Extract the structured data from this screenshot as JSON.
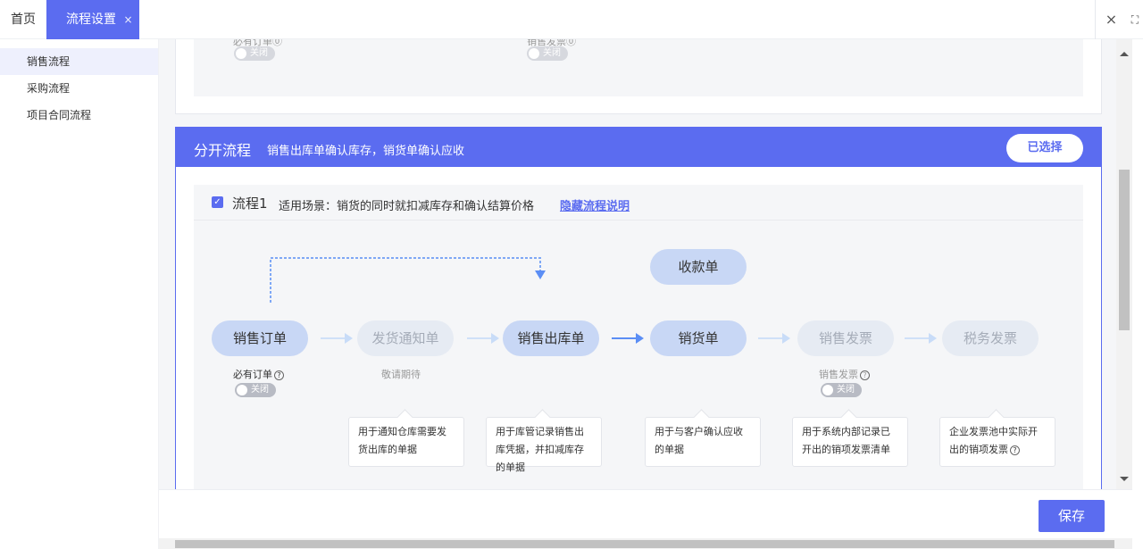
{
  "tabs": {
    "home": "首页",
    "active": "流程设置",
    "active_close": "×",
    "close_all": "×",
    "fullscreen": "⛶"
  },
  "sidebar": {
    "items": [
      {
        "label": "销售流程",
        "active": true
      },
      {
        "label": "采购流程",
        "active": false
      },
      {
        "label": "项目合同流程",
        "active": false
      }
    ]
  },
  "top_card": {
    "left_label": "必有订单",
    "left_toggle": "关闭",
    "right_label": "销售发票",
    "right_toggle": "关闭"
  },
  "flow": {
    "title": "分开流程",
    "subtitle": "销售出库单确认库存，销货单确认应收",
    "selected_label": "已选择",
    "option": {
      "checked": true,
      "name": "流程1",
      "scene": "适用场景：销货的同时就扣减库存和确认结算价格",
      "toggle_link": "隐藏流程说明"
    },
    "nodes": {
      "receipt": "收款单",
      "sales_order": "销售订单",
      "delivery_notice": "发货通知单",
      "sales_outbound": "销售出库单",
      "sales_doc": "销货单",
      "sales_invoice": "销售发票",
      "tax_invoice": "税务发票"
    },
    "sub_labels": {
      "must_order": "必有订单",
      "must_order_toggle": "关闭",
      "coming_soon": "敬请期待",
      "sales_invoice": "销售发票",
      "sales_invoice_toggle": "关闭"
    },
    "tips": {
      "delivery_notice": "用于通知仓库需要发货出库的单据",
      "sales_outbound": "用于库管记录销售出库凭据，并扣减库存的单据",
      "sales_doc": "用于与客户确认应收的单据",
      "sales_invoice": "用于系统内部记录已开出的销项发票清单",
      "tax_invoice": "企业发票池中实际开出的销项发票"
    }
  },
  "footer": {
    "save_label": "保存"
  },
  "colors": {
    "accent": "#5b6cf0",
    "node_active": "#c8d7f5",
    "node_inactive": "#e6ebf3",
    "arrow_solid": "#5b8ef5"
  }
}
